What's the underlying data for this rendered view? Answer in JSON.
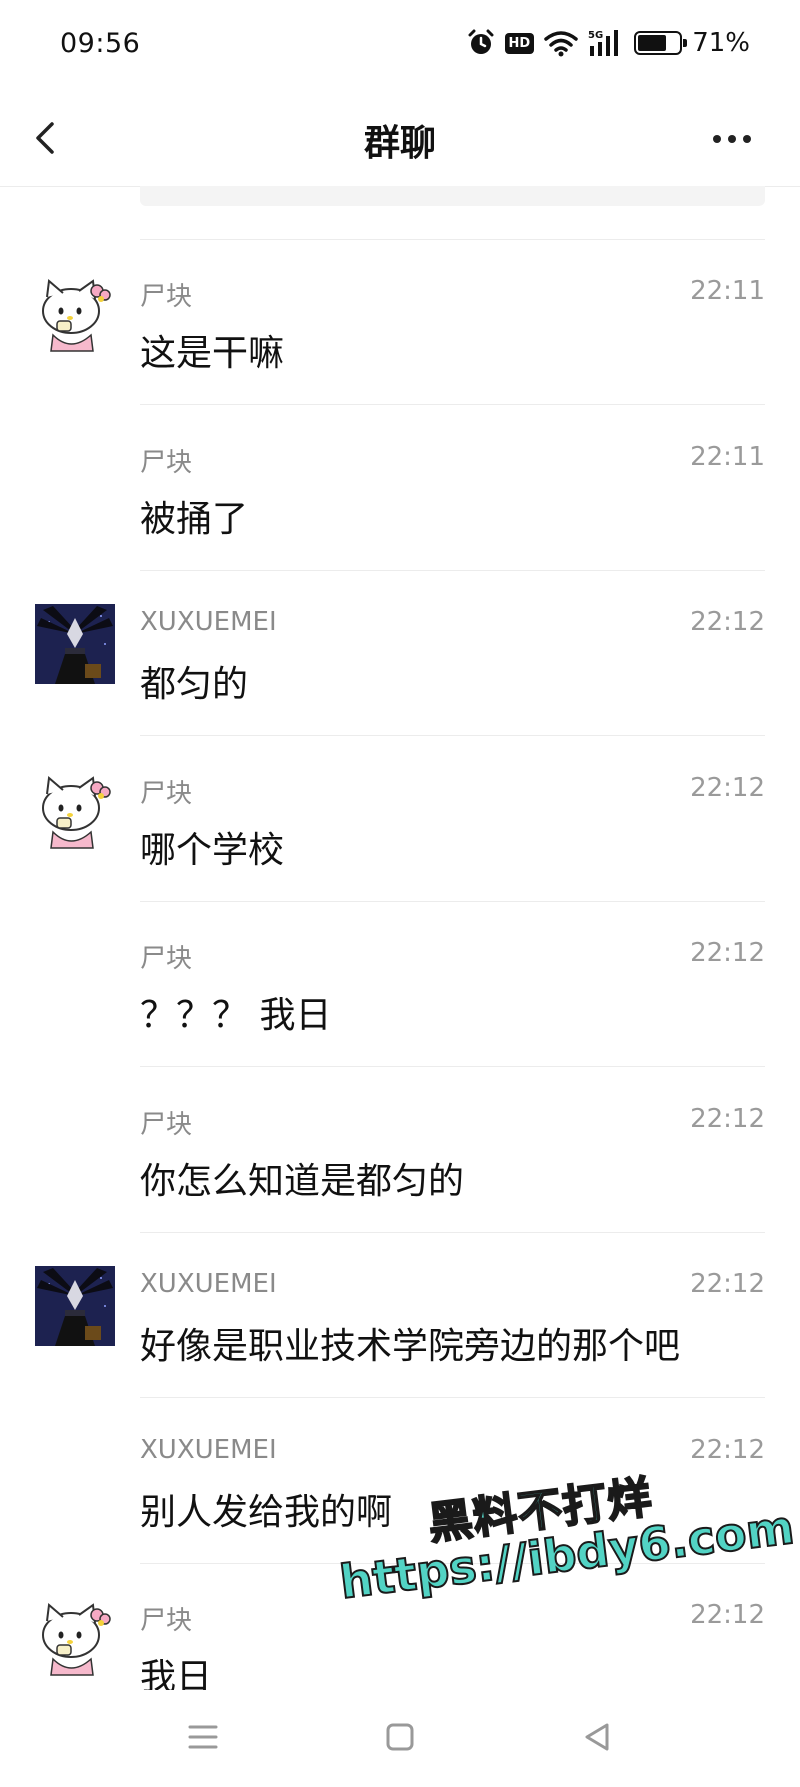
{
  "status_bar": {
    "time": "09:56",
    "network": "5G",
    "hd_label": "HD",
    "battery_percent_text": "71%",
    "battery_level": 0.71
  },
  "nav": {
    "title": "群聊",
    "back_icon": "chevron-left-icon",
    "more_icon": "more-horizontal-icon"
  },
  "messages": [
    {
      "sender": "尸块",
      "time": "22:11",
      "text": "这是干嘛",
      "avatar": "hello-kitty",
      "show_avatar": true
    },
    {
      "sender": "尸块",
      "time": "22:11",
      "text": "被捅了",
      "avatar": "hello-kitty",
      "show_avatar": false
    },
    {
      "sender": "XUXUEMEI",
      "time": "22:12",
      "text": "都匀的",
      "avatar": "dark-figure",
      "show_avatar": true
    },
    {
      "sender": "尸块",
      "time": "22:12",
      "text": "哪个学校",
      "avatar": "hello-kitty",
      "show_avatar": true
    },
    {
      "sender": "尸块",
      "time": "22:12",
      "text": "？？？ 我日",
      "avatar": "hello-kitty",
      "show_avatar": false
    },
    {
      "sender": "尸块",
      "time": "22:12",
      "text": "你怎么知道是都匀的",
      "avatar": "hello-kitty",
      "show_avatar": false
    },
    {
      "sender": "XUXUEMEI",
      "time": "22:12",
      "text": "好像是职业技术学院旁边的那个吧",
      "avatar": "dark-figure",
      "show_avatar": true
    },
    {
      "sender": "XUXUEMEI",
      "time": "22:12",
      "text": "别人发给我的啊",
      "avatar": "dark-figure",
      "show_avatar": false
    },
    {
      "sender": "尸块",
      "time": "22:12",
      "text": "我日",
      "avatar": "hello-kitty",
      "show_avatar": true
    }
  ],
  "watermark": {
    "line1": "黑料不打烊",
    "line2": "https://ibdy6.com"
  },
  "bottom_nav": {
    "items": [
      "menu-icon",
      "home-square-icon",
      "back-triangle-icon"
    ]
  }
}
